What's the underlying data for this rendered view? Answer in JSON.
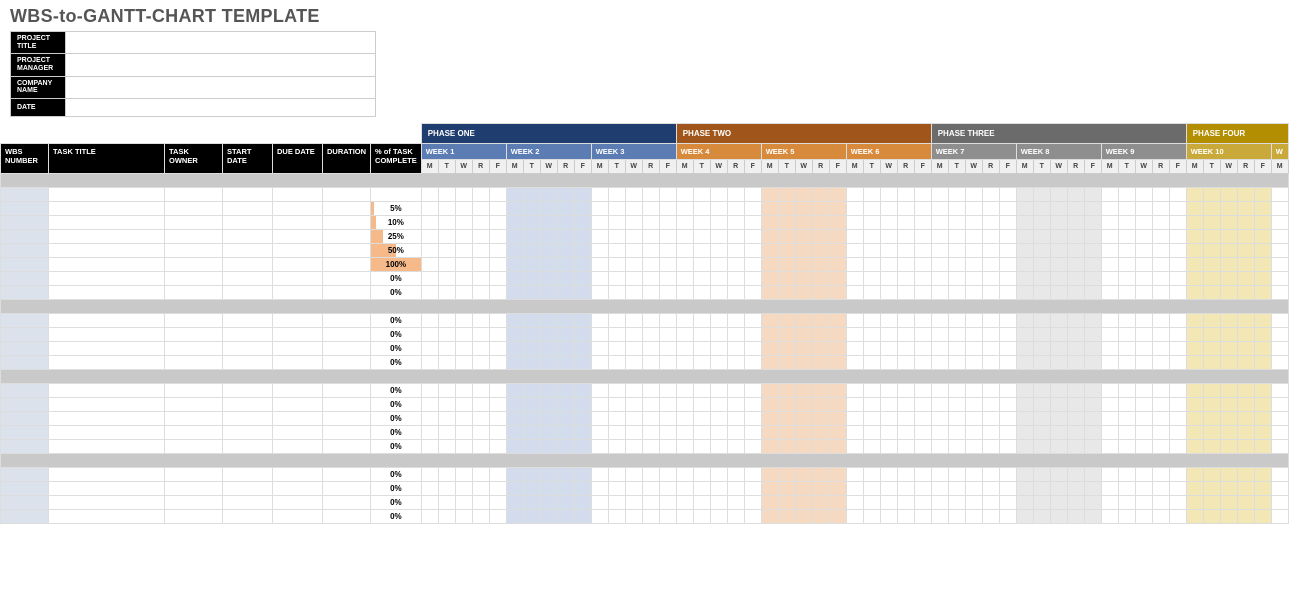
{
  "title": "WBS-to-GANTT-CHART TEMPLATE",
  "meta": {
    "fields": [
      "PROJECT TITLE",
      "PROJECT MANAGER",
      "COMPANY NAME",
      "DATE"
    ],
    "values": [
      "",
      "",
      "",
      ""
    ]
  },
  "columns": {
    "wbs": "WBS NUMBER",
    "task_title": "TASK TITLE",
    "task_owner": "TASK OWNER",
    "start_date": "START DATE",
    "due_date": "DUE DATE",
    "duration": "DURATION",
    "pct": "% of TASK COMPLETE"
  },
  "phases": [
    {
      "label": "PHASE ONE",
      "class": "phase-one"
    },
    {
      "label": "PHASE TWO",
      "class": "phase-two"
    },
    {
      "label": "PHASE THREE",
      "class": "phase-three"
    },
    {
      "label": "PHASE FOUR",
      "class": "phase-four"
    }
  ],
  "weeks": [
    {
      "label": "WEEK 1",
      "class": "wk-blue",
      "shade_idx": 1
    },
    {
      "label": "WEEK 2",
      "class": "wk-blue",
      "shade": "blue",
      "shade_idx": 2
    },
    {
      "label": "WEEK 3",
      "class": "wk-blue"
    },
    {
      "label": "WEEK 4",
      "class": "wk-orange"
    },
    {
      "label": "WEEK 5",
      "class": "wk-orange",
      "shade": "orange"
    },
    {
      "label": "WEEK 6",
      "class": "wk-orange"
    },
    {
      "label": "WEEK 7",
      "class": "wk-gray"
    },
    {
      "label": "WEEK 8",
      "class": "wk-gray",
      "shade": "gray"
    },
    {
      "label": "WEEK 9",
      "class": "wk-gray"
    },
    {
      "label": "WEEK 10",
      "class": "wk-yellow",
      "shade": "yellow"
    },
    {
      "label": "W",
      "class": "wk-yellow",
      "partial": true
    }
  ],
  "days": [
    "M",
    "T",
    "W",
    "R",
    "F"
  ],
  "groups": [
    {
      "sep": true,
      "rows": [
        {
          "pct": ""
        },
        {
          "pct": "5%",
          "bar": 5
        },
        {
          "pct": "10%",
          "bar": 10
        },
        {
          "pct": "25%",
          "bar": 25
        },
        {
          "pct": "50%",
          "bar": 50
        },
        {
          "pct": "100%",
          "bar": 100
        },
        {
          "pct": "0%",
          "bar": 0
        },
        {
          "pct": "0%",
          "bar": 0
        }
      ]
    },
    {
      "sep": true,
      "rows": [
        {
          "pct": "0%",
          "bar": 0
        },
        {
          "pct": "0%",
          "bar": 0
        },
        {
          "pct": "0%",
          "bar": 0
        },
        {
          "pct": "0%",
          "bar": 0
        }
      ]
    },
    {
      "sep": true,
      "rows": [
        {
          "pct": "0%",
          "bar": 0
        },
        {
          "pct": "0%",
          "bar": 0
        },
        {
          "pct": "0%",
          "bar": 0
        },
        {
          "pct": "0%",
          "bar": 0
        },
        {
          "pct": "0%",
          "bar": 0
        }
      ]
    },
    {
      "sep": true,
      "rows": [
        {
          "pct": "0%",
          "bar": 0
        },
        {
          "pct": "0%",
          "bar": 0
        },
        {
          "pct": "0%",
          "bar": 0
        },
        {
          "pct": "0%",
          "bar": 0
        }
      ]
    }
  ]
}
